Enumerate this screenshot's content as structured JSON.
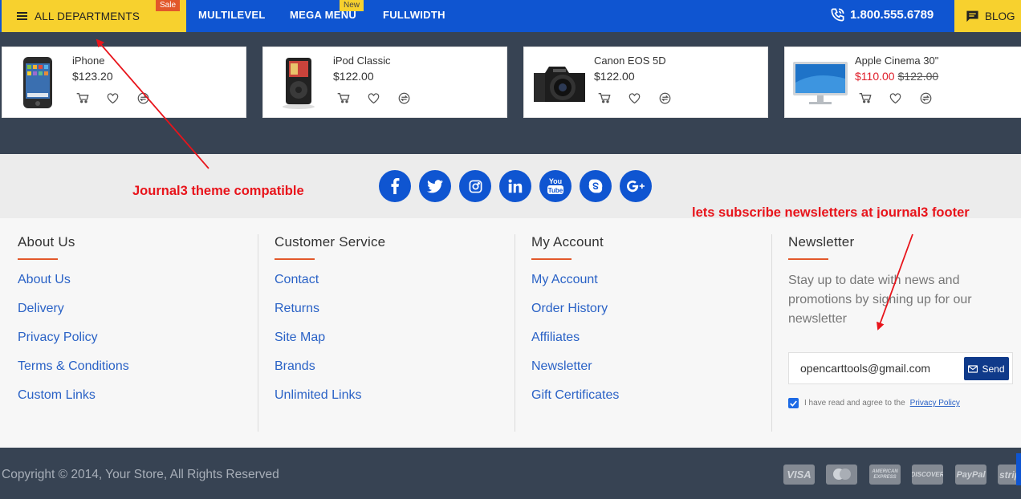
{
  "nav": {
    "departments_label": "ALL DEPARTMENTS",
    "sale_badge": "Sale",
    "new_badge": "New",
    "items": [
      {
        "label": "MULTILEVEL"
      },
      {
        "label": "MEGA MENU"
      },
      {
        "label": "FULLWIDTH"
      }
    ],
    "phone": "1.800.555.6789",
    "blog_label": "BLOG"
  },
  "products": [
    {
      "name": "iPhone",
      "price": "$123.20",
      "old_price": ""
    },
    {
      "name": "iPod Classic",
      "price": "$122.00",
      "old_price": ""
    },
    {
      "name": "Canon EOS 5D",
      "price": "$122.00",
      "old_price": ""
    },
    {
      "name": "Apple Cinema 30\"",
      "price": "$110.00",
      "old_price": "$122.00"
    }
  ],
  "social_icons": [
    "facebook-icon",
    "twitter-icon",
    "instagram-icon",
    "linkedin-icon",
    "youtube-icon",
    "skype-icon",
    "google-plus-icon"
  ],
  "annotations": {
    "theme": "Journal3 theme compatible",
    "newsletter": "lets subscribe newsletters at journal3 footer"
  },
  "footer": {
    "columns": [
      {
        "title": "About Us",
        "links": [
          "About Us",
          "Delivery",
          "Privacy Policy",
          "Terms & Conditions",
          "Custom Links"
        ]
      },
      {
        "title": "Customer Service",
        "links": [
          "Contact",
          "Returns",
          "Site Map",
          "Brands",
          "Unlimited Links"
        ]
      },
      {
        "title": "My Account",
        "links": [
          "My Account",
          "Order History",
          "Affiliates",
          "Newsletter",
          "Gift Certificates"
        ]
      }
    ],
    "newsletter": {
      "title": "Newsletter",
      "text": "Stay up to date with news and promotions by signing up for our newsletter",
      "email_value": "opencarttools@gmail.com",
      "send_label": "Send",
      "agree_text": "I have read and agree to the",
      "privacy_link": "Privacy Policy"
    }
  },
  "bottom": {
    "copyright": "Copyright © 2014, Your Store, All Rights Reserved",
    "payments": [
      "VISA",
      "",
      "AMERICAN EXPRESS",
      "DISCOVER",
      "PayPal",
      "stripe"
    ]
  },
  "colors": {
    "brand_blue": "#0f55d1",
    "accent_yellow": "#f7d12e",
    "dark_bg": "#374353",
    "annotation_red": "#e8141b"
  }
}
